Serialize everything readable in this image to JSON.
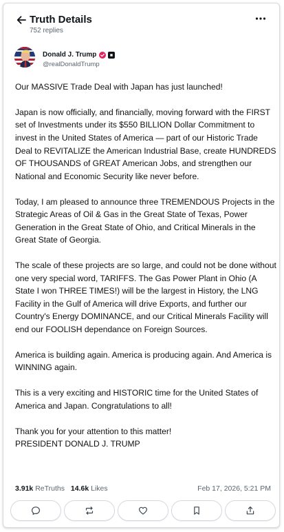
{
  "header": {
    "title": "Truth Details",
    "replies": "752 replies"
  },
  "author": {
    "name": "Donald J. Trump",
    "handle": "@realDonaldTrump"
  },
  "post": {
    "paragraphs": [
      "Our MASSIVE Trade Deal with Japan has just launched!",
      "Japan is now officially, and financially, moving forward with the FIRST set of Investments under its $550 BILLION Dollar Commitment to invest in the United States of America — part of our Historic Trade Deal to REVITALIZE the American Industrial Base, create HUNDREDS OF THOUSANDS of GREAT American Jobs, and strengthen our National and Economic Security like never before.",
      "Today, I am pleased to announce three TREMENDOUS Projects in the Strategic Areas of Oil & Gas in the Great State of Texas, Power Generation in the Great State of Ohio, and Critical Minerals in the Great State of Georgia.",
      "The scale of these projects are so large, and could not be done without one very special word, TARIFFS. The Gas Power Plant in Ohio (A State I won THREE TIMES!) will be the largest in History, the LNG Facility in the Gulf of America will drive Exports, and further our Country's Energy DOMINANCE, and our Critical Minerals Facility will end our FOOLISH dependance on Foreign Sources.",
      "America is building again. America is producing again. And America is WINNING again.",
      "This is a very exciting and HISTORIC time for the United States of America and Japan. Congratulations to all!"
    ],
    "closing_line1": "Thank you for your attention to this matter!",
    "closing_line2": "PRESIDENT DONALD J. TRUMP"
  },
  "stats": {
    "retruths_count": "3.91k",
    "retruths_label": "ReTruths",
    "likes_count": "14.6k",
    "likes_label": "Likes",
    "date": "Feb 17, 2026, 5:21 PM"
  },
  "actions": [
    "reply-icon",
    "retruth-icon",
    "like-icon",
    "bookmark-icon",
    "share-icon"
  ],
  "colors": {
    "verified": "#e0245e",
    "text": "#111111",
    "muted": "#5b6470",
    "border": "#d6d9dd"
  }
}
